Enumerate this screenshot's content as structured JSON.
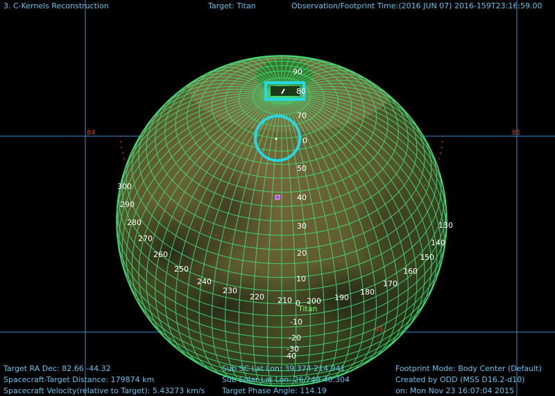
{
  "header": {
    "title": "3. C-Kernels Reconstruction",
    "target": "Target: Titan",
    "time": "Observation/Footprint Time:(2016 JUN 07) 2016-159T23:16:59.00"
  },
  "footer": {
    "left": [
      "Target RA Dec: 82.66  -44.32",
      "Spacecraft-Target Distance:  179874 km",
      "Spacecraft Velocity(relative to Target): 5.43273 km/s"
    ],
    "middle": [
      "Sub SC Lat Lon: 39.374  214.941",
      "Sub Solar Lat Lon: 26.248  40.304",
      "Target Phase Angle: 114.19"
    ],
    "right": [
      "Footprint Mode: Body Center (Default)",
      "Created by ODD (MSS D16.2-d10)",
      "on: Mon Nov 23 16:07:04 2015"
    ]
  },
  "body_label": "Titan",
  "grid_labels": {
    "84_left": "84",
    "81_right": "81",
    "45_bottom": "45"
  },
  "latitude_labels": [
    "90",
    "80",
    "70",
    "0",
    "50",
    "40",
    "30",
    "20",
    "10",
    "0",
    "-10",
    "-20",
    "-30",
    "-40"
  ],
  "longitude_labels": [
    "300",
    "290",
    "280",
    "270",
    "260",
    "250",
    "240",
    "230",
    "220",
    "210",
    "200",
    "190",
    "180",
    "170",
    "160",
    "150",
    "140",
    "130"
  ],
  "colors": {
    "grid": "#3fe07a",
    "footprint": "#25d8e8",
    "text": "#5ec8f2",
    "marker": "#c040ff",
    "ring_dots": "#d03a2a"
  }
}
